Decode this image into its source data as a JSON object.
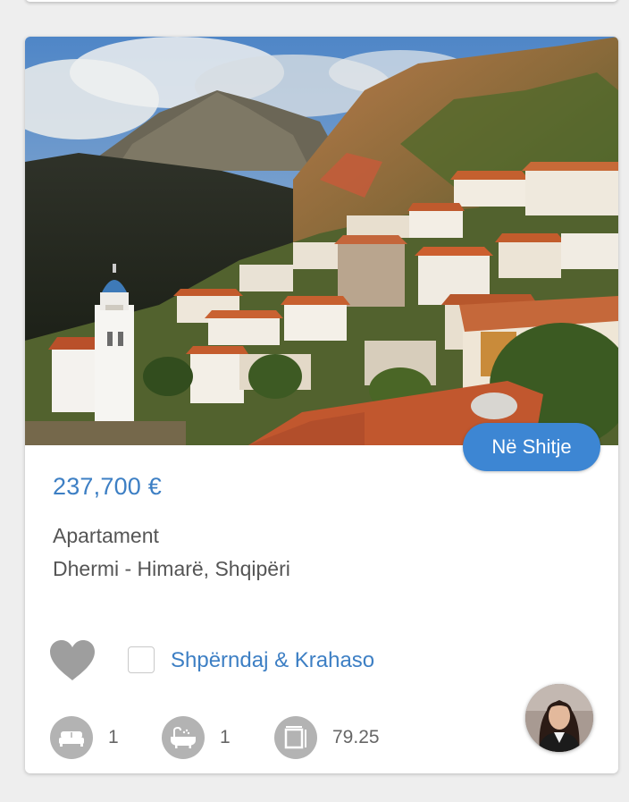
{
  "listing": {
    "status_badge": "Në Shitje",
    "price": "237,700 €",
    "property_type": "Apartament",
    "location": "Dhermi - Himarë, Shqipëri",
    "compare_label": "Shpërndaj & Krahaso",
    "compare_checked": false,
    "features": {
      "bedrooms": "1",
      "bathrooms": "1",
      "area": "79.25"
    }
  },
  "colors": {
    "accent": "#3d86d3",
    "price_text": "#3d7fc4",
    "icon_gray": "#b3b3b3"
  },
  "icons": {
    "favorite": "heart-icon",
    "bed": "bed-icon",
    "bath": "bathtub-icon",
    "area": "area-icon"
  }
}
